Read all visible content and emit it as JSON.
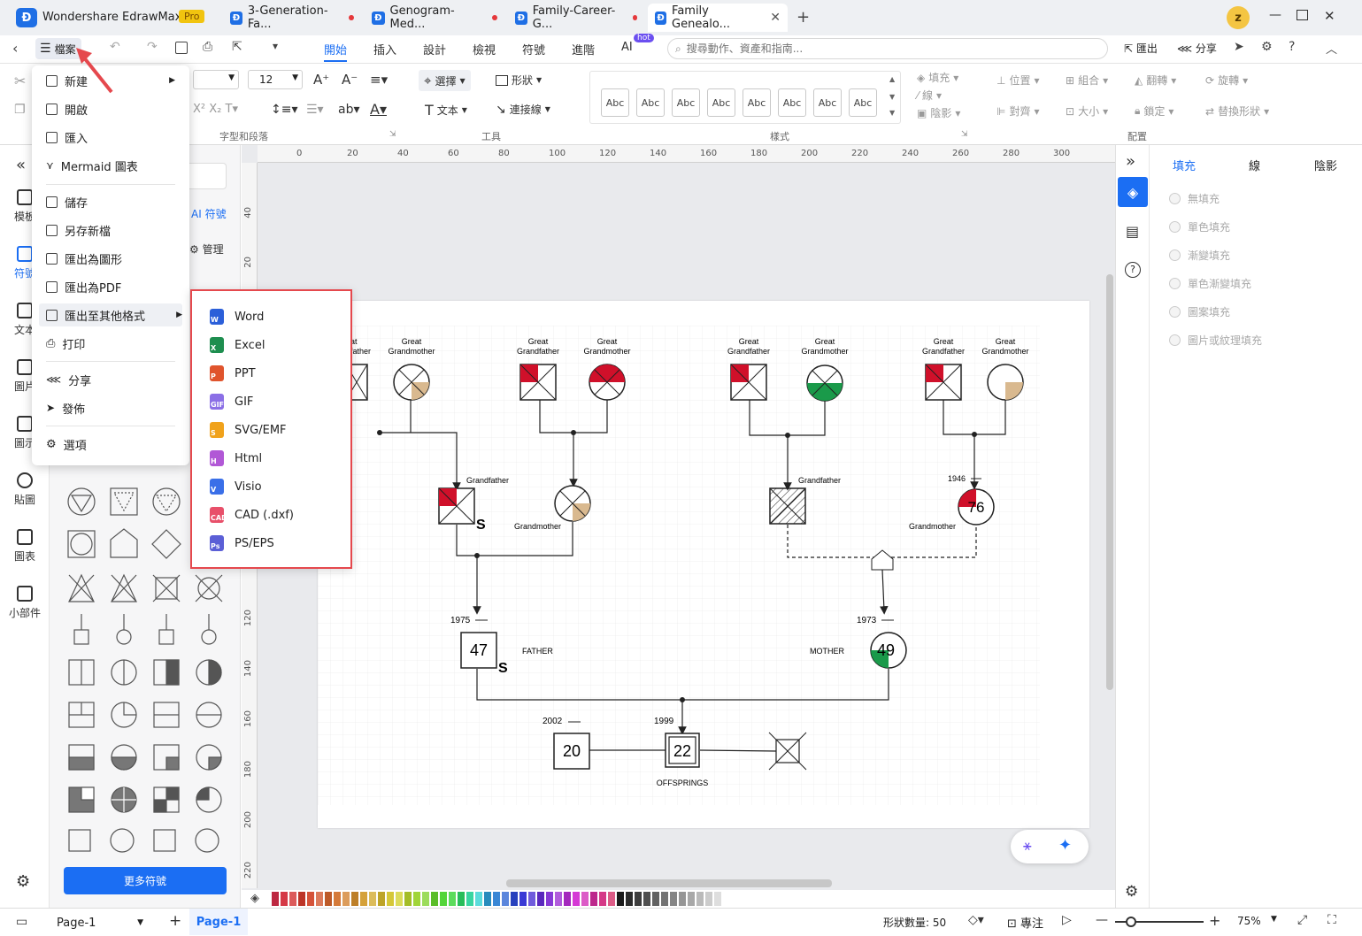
{
  "titlebar": {
    "app_name": "Wondershare EdrawMax",
    "badge": "Pro",
    "tabs": [
      {
        "label": "3-Generation-Fa..."
      },
      {
        "label": "Genogram-Med..."
      },
      {
        "label": "Family-Career-G..."
      },
      {
        "label": "Family Genealo..."
      }
    ],
    "avatar_letter": "z"
  },
  "menubar": {
    "file_label": "檔案",
    "tabs": [
      "開始",
      "插入",
      "設計",
      "檢視",
      "符號",
      "進階",
      "AI"
    ],
    "ai_badge": "hot",
    "search_placeholder": "搜尋動作、資產和指南...",
    "export_label": "匯出",
    "share_label": "分享"
  },
  "ribbon": {
    "font_size": "12",
    "select_label": "選擇",
    "shape_label": "形狀",
    "text_label": "文本",
    "connector_label": "連接線",
    "font_group_label": "字型和段落",
    "tools_group_label": "工具",
    "style_group_label": "樣式",
    "arrange_group_label": "配置",
    "style_swatch_label": "Abc",
    "fill_label": "填充",
    "line_label": "線",
    "shadow_label": "陰影",
    "position_label": "位置",
    "group_label": "組合",
    "flip_label": "翻轉",
    "rotate_label": "旋轉",
    "align_label": "對齊",
    "size_label": "大小",
    "lock_label": "鎖定",
    "replace_label": "替換形狀"
  },
  "leftrail": {
    "items": [
      "模板",
      "符號",
      "文本",
      "圖片",
      "圖示",
      "貼圖",
      "圖表",
      "小部件"
    ]
  },
  "symbolpanel": {
    "ai_symbols": "AI 符號",
    "manage": "管理",
    "more_button": "更多符號"
  },
  "filemenu": {
    "items": [
      "新建",
      "開啟",
      "匯入",
      "Mermaid 圖表",
      "儲存",
      "另存新檔",
      "匯出為圖形",
      "匯出為PDF",
      "匯出至其他格式",
      "打印",
      "分享",
      "發佈",
      "選項"
    ]
  },
  "submenu": {
    "items": [
      {
        "label": "Word",
        "color": "#2b5fd9",
        "glyph": "W"
      },
      {
        "label": "Excel",
        "color": "#1e8e4f",
        "glyph": "X"
      },
      {
        "label": "PPT",
        "color": "#e0542d",
        "glyph": "P"
      },
      {
        "label": "GIF",
        "color": "#8b6fe6",
        "glyph": "GIF"
      },
      {
        "label": "SVG/EMF",
        "color": "#f0a21b",
        "glyph": "S"
      },
      {
        "label": "Html",
        "color": "#b158d6",
        "glyph": "H"
      },
      {
        "label": "Visio",
        "color": "#3a6fe8",
        "glyph": "V"
      },
      {
        "label": "CAD (.dxf)",
        "color": "#e8506a",
        "glyph": "CAD"
      },
      {
        "label": "PS/EPS",
        "color": "#5b5fd6",
        "glyph": "Ps"
      }
    ]
  },
  "diagram": {
    "great_grandfather": "Great Grandfather",
    "great_grandmother": "Great Grandmother",
    "grandfather": "Grandfather",
    "grandmother": "Grandmother",
    "father_label": "FATHER",
    "mother_label": "MOTHER",
    "offsprings_label": "OFFSPRINGS",
    "father_age": "47",
    "father_year": "1975",
    "mother_age": "49",
    "mother_year": "1973",
    "grandmother_age": "76",
    "grandmother_year": "1946",
    "child1_age": "20",
    "child1_year": "2002",
    "child2_age": "22",
    "child2_year": "1999",
    "s_mark": "S",
    "s_mark2": "S"
  },
  "rightpanel": {
    "tabs": [
      "填充",
      "線",
      "陰影"
    ],
    "options": [
      "無填充",
      "單色填充",
      "漸變填充",
      "單色漸變填充",
      "圖案填充",
      "圖片或紋理填充"
    ]
  },
  "statusbar": {
    "page_selector": "Page-1",
    "page_tab": "Page-1",
    "shape_count": "形狀數量: 50",
    "focus_label": "專注",
    "zoom": "75%"
  },
  "ruler": {
    "h_ticks": [
      "0",
      "20",
      "40",
      "60",
      "80",
      "100",
      "120",
      "140",
      "160",
      "180",
      "200",
      "220",
      "240",
      "260",
      "280",
      "300"
    ],
    "v_ticks": [
      "40",
      "20",
      "120",
      "140",
      "160",
      "180",
      "200",
      "220"
    ]
  },
  "colors": {
    "accent": "#1b6ef3",
    "highlight_red": "#e5484d",
    "genogram_red": "#d0102a",
    "genogram_green": "#1a9a4a",
    "genogram_tan": "#d9b98f"
  }
}
